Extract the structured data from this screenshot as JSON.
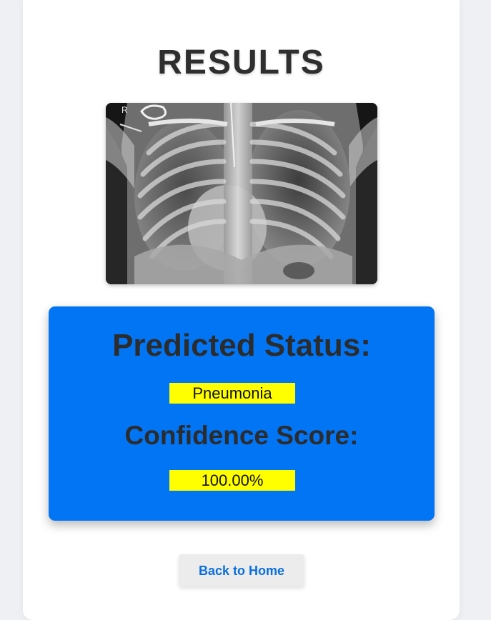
{
  "page": {
    "title": "RESULTS",
    "background_color": "#eef0f4",
    "card_color": "#ffffff"
  },
  "image": {
    "description_icon": "chest-xray-image",
    "marker_label": "R"
  },
  "prediction": {
    "status_heading": "Predicted Status:",
    "status_value": "Pneumonia",
    "score_heading": "Confidence Score:",
    "score_value": "100.00%",
    "panel_color": "#0275f5",
    "highlight_color": "#ffff00"
  },
  "actions": {
    "back_label": "Back to Home",
    "link_color": "#0a6fdc"
  }
}
